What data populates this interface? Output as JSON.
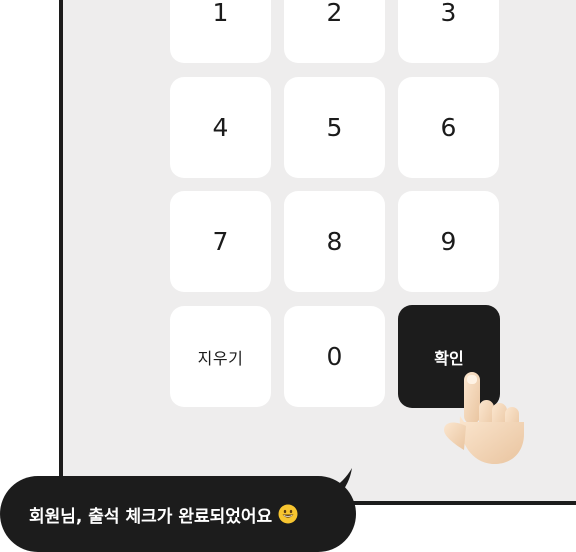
{
  "keypad": {
    "keys": [
      {
        "label": "1"
      },
      {
        "label": "2"
      },
      {
        "label": "3"
      },
      {
        "label": "4"
      },
      {
        "label": "5"
      },
      {
        "label": "6"
      },
      {
        "label": "7"
      },
      {
        "label": "8"
      },
      {
        "label": "9"
      },
      {
        "label": "지우기"
      },
      {
        "label": "0"
      },
      {
        "label": "확인"
      }
    ]
  },
  "message": {
    "text": "회원님, 출석 체크가 완료되었어요",
    "emoji": "grinning-face-emoji"
  },
  "colors": {
    "device_bg": "#eeeded",
    "frame": "#1c1c1c",
    "key_bg": "#ffffff",
    "confirm_bg": "#1c1c1c",
    "bubble_bg": "#1c1c1c"
  },
  "icons": {
    "pointer": "pointing-hand-icon"
  }
}
